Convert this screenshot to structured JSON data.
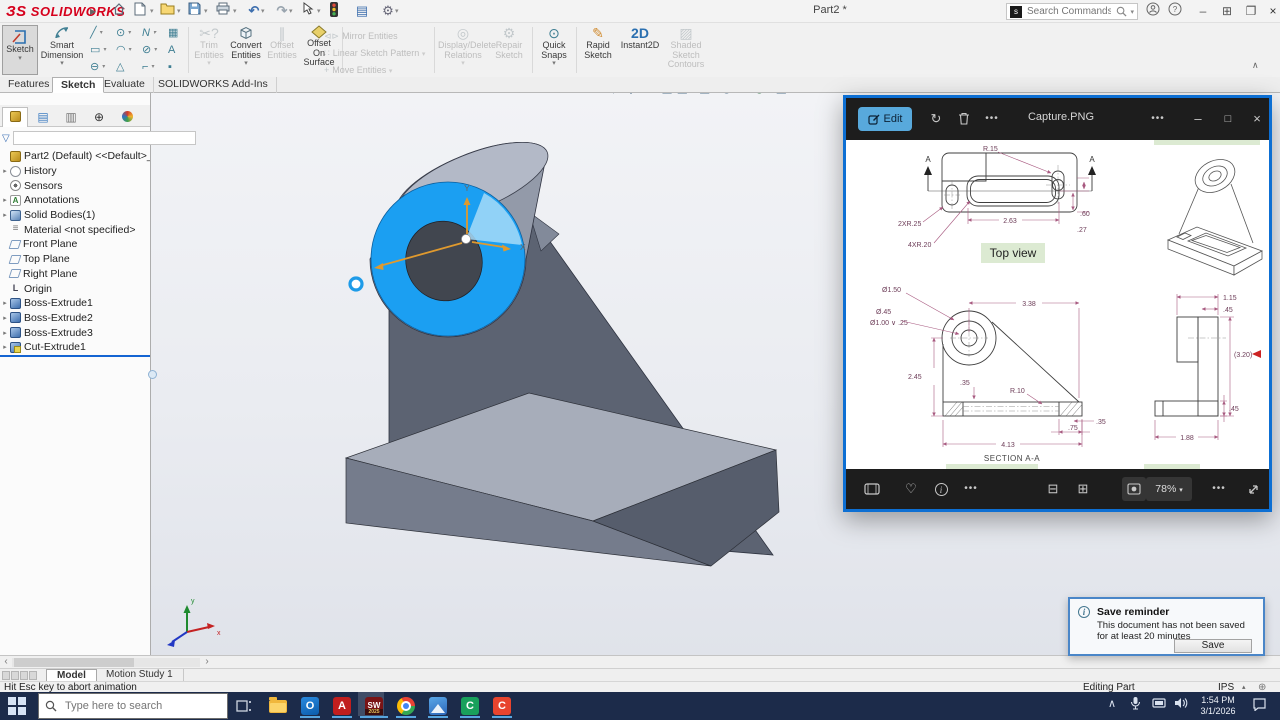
{
  "window": {
    "logo_mark": "ЗS",
    "logo_text": "SOLIDWORKS",
    "title": "Part2 *"
  },
  "menu": {
    "search_placeholder": "Search Commands"
  },
  "ribbon": {
    "sketch": "Sketch",
    "smart_dimension": "Smart Dimension",
    "trim": "Trim Entities",
    "convert": "Convert Entities",
    "offset": "Offset Entities",
    "offset_on_surface": "Offset On Surface",
    "mirror": "Mirror Entities",
    "linear_pattern": "Linear Sketch Pattern",
    "move": "Move Entities",
    "display_delete": "Display/Delete Relations",
    "repair": "Repair Sketch",
    "quick_snaps": "Quick Snaps",
    "rapid_sketch": "Rapid Sketch",
    "instant2d": "Instant2D",
    "shaded_contours": "Shaded Sketch Contours"
  },
  "command_tabs": [
    {
      "label": "Features"
    },
    {
      "label": "Sketch"
    },
    {
      "label": "Evaluate"
    },
    {
      "label": "SOLIDWORKS Add-Ins"
    }
  ],
  "tree": {
    "root": "Part2 (Default) <<Default>_Displa",
    "items": [
      {
        "label": "History"
      },
      {
        "label": "Sensors"
      },
      {
        "label": "Annotations"
      },
      {
        "label": "Solid Bodies(1)"
      },
      {
        "label": "Material <not specified>"
      },
      {
        "label": "Front Plane"
      },
      {
        "label": "Top Plane"
      },
      {
        "label": "Right Plane"
      },
      {
        "label": "Origin"
      },
      {
        "label": "Boss-Extrude1"
      },
      {
        "label": "Boss-Extrude2"
      },
      {
        "label": "Boss-Extrude3"
      },
      {
        "label": "Cut-Extrude1"
      }
    ]
  },
  "viewport": {
    "axis_y": "Y",
    "axis_x": "X",
    "triad_y": "y",
    "triad_x": "x"
  },
  "photos": {
    "title": "Capture.PNG",
    "edit_label": "Edit",
    "zoom_level": "78%"
  },
  "drawing": {
    "top_view": {
      "label": "Top view",
      "r15": "R.15",
      "a_left": "A",
      "a_right": "A",
      "r25": "2XR.25",
      "r20": "4XR.20",
      "w": "2.63",
      "h1": ".60",
      "h2": ".27"
    },
    "section": {
      "label": "SECTION A-A",
      "d_boss": "Ø1.50",
      "d_hole": "Ø.45",
      "cbore": "Ø1.00 ∨ .25",
      "w_top": "3.38",
      "h_left": "2.45",
      "slot_t": ".35",
      "r_slot": "R.10",
      "edge_t": ".35",
      "off": ".75",
      "w_base": "4.13"
    },
    "side": {
      "w_top": "1.15",
      "t_top": ".45",
      "h_total": "(3.20)",
      "t_base": ".45",
      "w_base": "1.88"
    }
  },
  "save_reminder": {
    "title": "Save reminder",
    "body": "This document has not been saved for at least 20 minutes",
    "button": "Save"
  },
  "status": {
    "message": "Hit Esc key to abort animation",
    "mode": "Editing Part",
    "units": "IPS"
  },
  "bottom_tabs": {
    "model": "Model",
    "motion": "Motion Study 1"
  },
  "taskbar": {
    "search_placeholder": "Type here to search",
    "time": "1:54 PM",
    "date": "3/1/2026"
  },
  "icons": {
    "dropdown": "▾",
    "collapse_chevron": "∧",
    "overflow": "•••",
    "heart": "♡",
    "line": "╱",
    "circle": "⊙",
    "spline": "N",
    "sketch_picture": "▦",
    "rectangle": "▭",
    "arc": "◠",
    "ellipse": "⊘",
    "text": "A",
    "slot": "⊖",
    "polygon": "△",
    "fillet": "⌐",
    "point": "▪",
    "mirror": "⊲⊳",
    "pattern": "∷",
    "move": "+",
    "display_relations": "◎",
    "repair": "⚙",
    "quick_snaps": "⊙",
    "rapid": "✎",
    "instant2d": "2D",
    "shaded": "▨",
    "undo": "↶",
    "redo": "↷",
    "list": "▤",
    "gear": "⚙",
    "minimize": "–",
    "maximize": "□",
    "restore": "❐",
    "split": "⊞",
    "close": "×",
    "zoom_out": "⊟",
    "zoom_in": "⊞",
    "rotate": "↻",
    "filter": "▽",
    "left": "‹",
    "right": "›",
    "help": "?",
    "section_view": "◑",
    "view_cube": "▧",
    "eye": "◉",
    "appearance": "◓",
    "scene": "◎",
    "monitor": "▣",
    "units_caret": "▴",
    "tray_chevron": "∧",
    "globe": "⊕"
  },
  "colors": {
    "accent_blue": "#1e9be8",
    "selection_blue": "#1b9ff2",
    "photos_border": "#0d6fd3",
    "dim_maroon": "#a85a80",
    "highlight_green": "#dcead2",
    "taskbar_navy": "#1c2b4a",
    "logo_red": "#d6001c"
  }
}
